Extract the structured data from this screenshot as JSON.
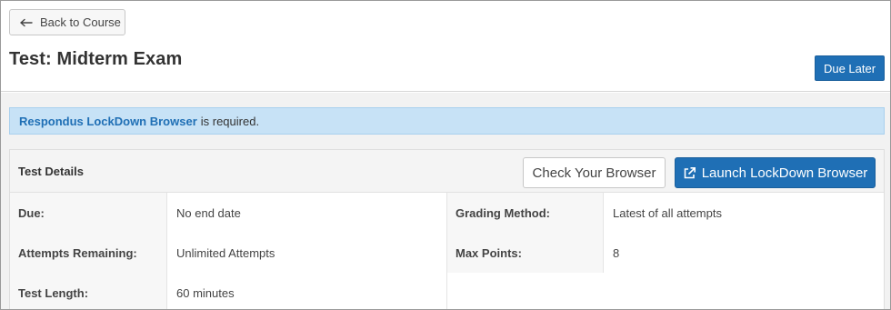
{
  "header": {
    "back_label": "Back to Course",
    "page_title": "Test: Midterm Exam",
    "due_label": "Due Later"
  },
  "alert": {
    "link_text": "Respondus LockDown Browser",
    "suffix": "is required."
  },
  "details": {
    "title": "Test Details",
    "check_label": "Check Your Browser",
    "launch_label": "Launch LockDown Browser",
    "rows": [
      {
        "label1": "Due:",
        "value1": "No end date",
        "label2": "Grading Method:",
        "value2": "Latest of all attempts"
      },
      {
        "label1": "Attempts Remaining:",
        "value1": "Unlimited Attempts",
        "label2": "Max Points:",
        "value2": "8"
      },
      {
        "label1": "Test Length:",
        "value1": "60 minutes"
      }
    ]
  },
  "colors": {
    "primary": "#1f6fb5",
    "alert_bg": "#c7e2f6",
    "page_bg": "#f2f2f2"
  },
  "icons": {
    "back": "arrow-left-icon",
    "launch": "external-link-icon"
  }
}
